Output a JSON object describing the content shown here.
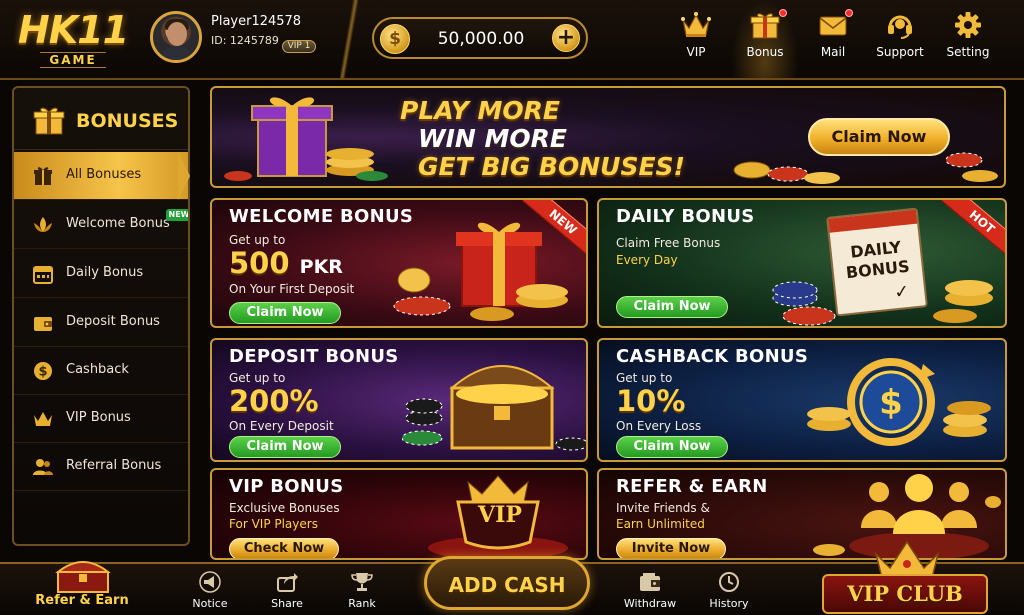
{
  "header": {
    "logo_main": "HK11",
    "logo_sub": "GAME",
    "player_name": "Player124578",
    "player_id": "ID: 1245789",
    "vip_level": "VIP 1",
    "balance": "50,000.00",
    "nav": [
      {
        "label": "VIP",
        "icon": "crown-icon",
        "dot": false
      },
      {
        "label": "Bonus",
        "icon": "gift-icon",
        "dot": true
      },
      {
        "label": "Mail",
        "icon": "mail-icon",
        "dot": true
      },
      {
        "label": "Support",
        "icon": "headset-icon",
        "dot": false
      },
      {
        "label": "Setting",
        "icon": "gear-icon",
        "dot": false
      }
    ]
  },
  "sidebar": {
    "title": "BONUSES",
    "items": [
      {
        "label": "All Bonuses",
        "icon": "gift-icon",
        "active": true
      },
      {
        "label": "Welcome Bonus",
        "icon": "lotus-icon",
        "badge": "NEW"
      },
      {
        "label": "Daily Bonus",
        "icon": "calendar-icon"
      },
      {
        "label": "Deposit Bonus",
        "icon": "wallet-icon"
      },
      {
        "label": "Cashback",
        "icon": "dollar-coin-icon"
      },
      {
        "label": "VIP Bonus",
        "icon": "crown-icon"
      },
      {
        "label": "Referral Bonus",
        "icon": "users-icon"
      }
    ]
  },
  "hero": {
    "line1": "PLAY MORE",
    "line2": "WIN MORE",
    "line3": "GET BIG BONUSES!",
    "cta": "Claim Now"
  },
  "cards": {
    "welcome": {
      "title": "WELCOME BONUS",
      "line1": "Get up to",
      "amount": "500",
      "unit": "PKR",
      "line2": "On Your First Deposit",
      "button": "Claim Now",
      "ribbon": "NEW"
    },
    "daily": {
      "title": "DAILY BONUS",
      "line1": "Claim Free Bonus",
      "highlight": "Every Day",
      "button": "Claim Now",
      "ribbon": "HOT",
      "calendar_text_1": "DAILY",
      "calendar_text_2": "BONUS"
    },
    "deposit": {
      "title": "DEPOSIT BONUS",
      "line1": "Get up to",
      "amount": "200%",
      "line2": "On Every Deposit",
      "button": "Claim Now"
    },
    "cashback": {
      "title": "CASHBACK BONUS",
      "line1": "Get up to",
      "amount": "10%",
      "line2": "On Every Loss",
      "button": "Claim Now"
    },
    "vip": {
      "title": "VIP BONUS",
      "line1": "Exclusive Bonuses",
      "highlight": "For VIP Players",
      "button": "Check Now",
      "emblem": "VIP"
    },
    "refer": {
      "title": "REFER & EARN",
      "line1": "Invite Friends &",
      "highlight": "Earn Unlimited",
      "button": "Invite Now"
    }
  },
  "bottom": {
    "refer": "Refer & Earn",
    "notice": "Notice",
    "share": "Share",
    "rank": "Rank",
    "add_cash": "ADD CASH",
    "withdraw": "Withdraw",
    "history": "History",
    "vip_club": "VIP CLUB"
  }
}
